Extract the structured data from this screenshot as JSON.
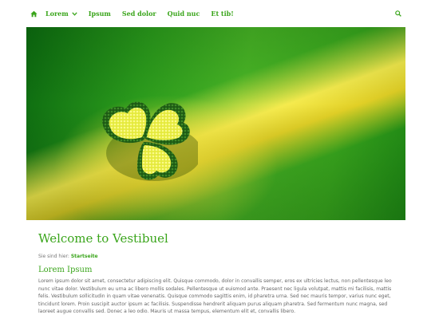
{
  "nav": {
    "home_icon": "home-icon",
    "items": [
      {
        "label": "Lorem",
        "has_dropdown": true
      },
      {
        "label": "Ipsum"
      },
      {
        "label": "Sed dolor"
      },
      {
        "label": "Quid nuc"
      },
      {
        "label": "Et tib!"
      }
    ],
    "search_icon": "search-icon"
  },
  "hero": {
    "image": "green-felt-clover-image"
  },
  "main": {
    "title": "Welcome to Vestibuel",
    "breadcrumb_prefix": "Sie sind hier:",
    "breadcrumb_link": "Startseite",
    "section_title": "Lorem Ipsum",
    "body": "Lorem ipsum dolor sit amet, consectetur adipiscing elit. Quisque commodo, dolor in convallis semper, eros ex ultricies lectus, non pellentesque leo nunc vitae dolor. Vestibulum eu urna ac libero mollis sodales. Pellentesque ut euismod ante. Praesent nec ligula volutpat, mattis mi facilisis, mattis felis. Vestibulum sollicitudin in quam vitae venenatis. Quisque commodo sagittis enim, id pharetra urna. Sed nec mauris tempor, varius nunc eget, tincidunt lorem. Proin suscipit auctor ipsum ac facilisis. Suspendisse hendrerit aliquam purus aliquam pharetra. Sed fermentum nunc magna, sed laoreet augue convallis sed. Donec a leo odio. Mauris ut massa tempus, elementum elit et, convallis libero."
  },
  "colors": {
    "accent": "#3aa51b",
    "text": "#666666"
  }
}
